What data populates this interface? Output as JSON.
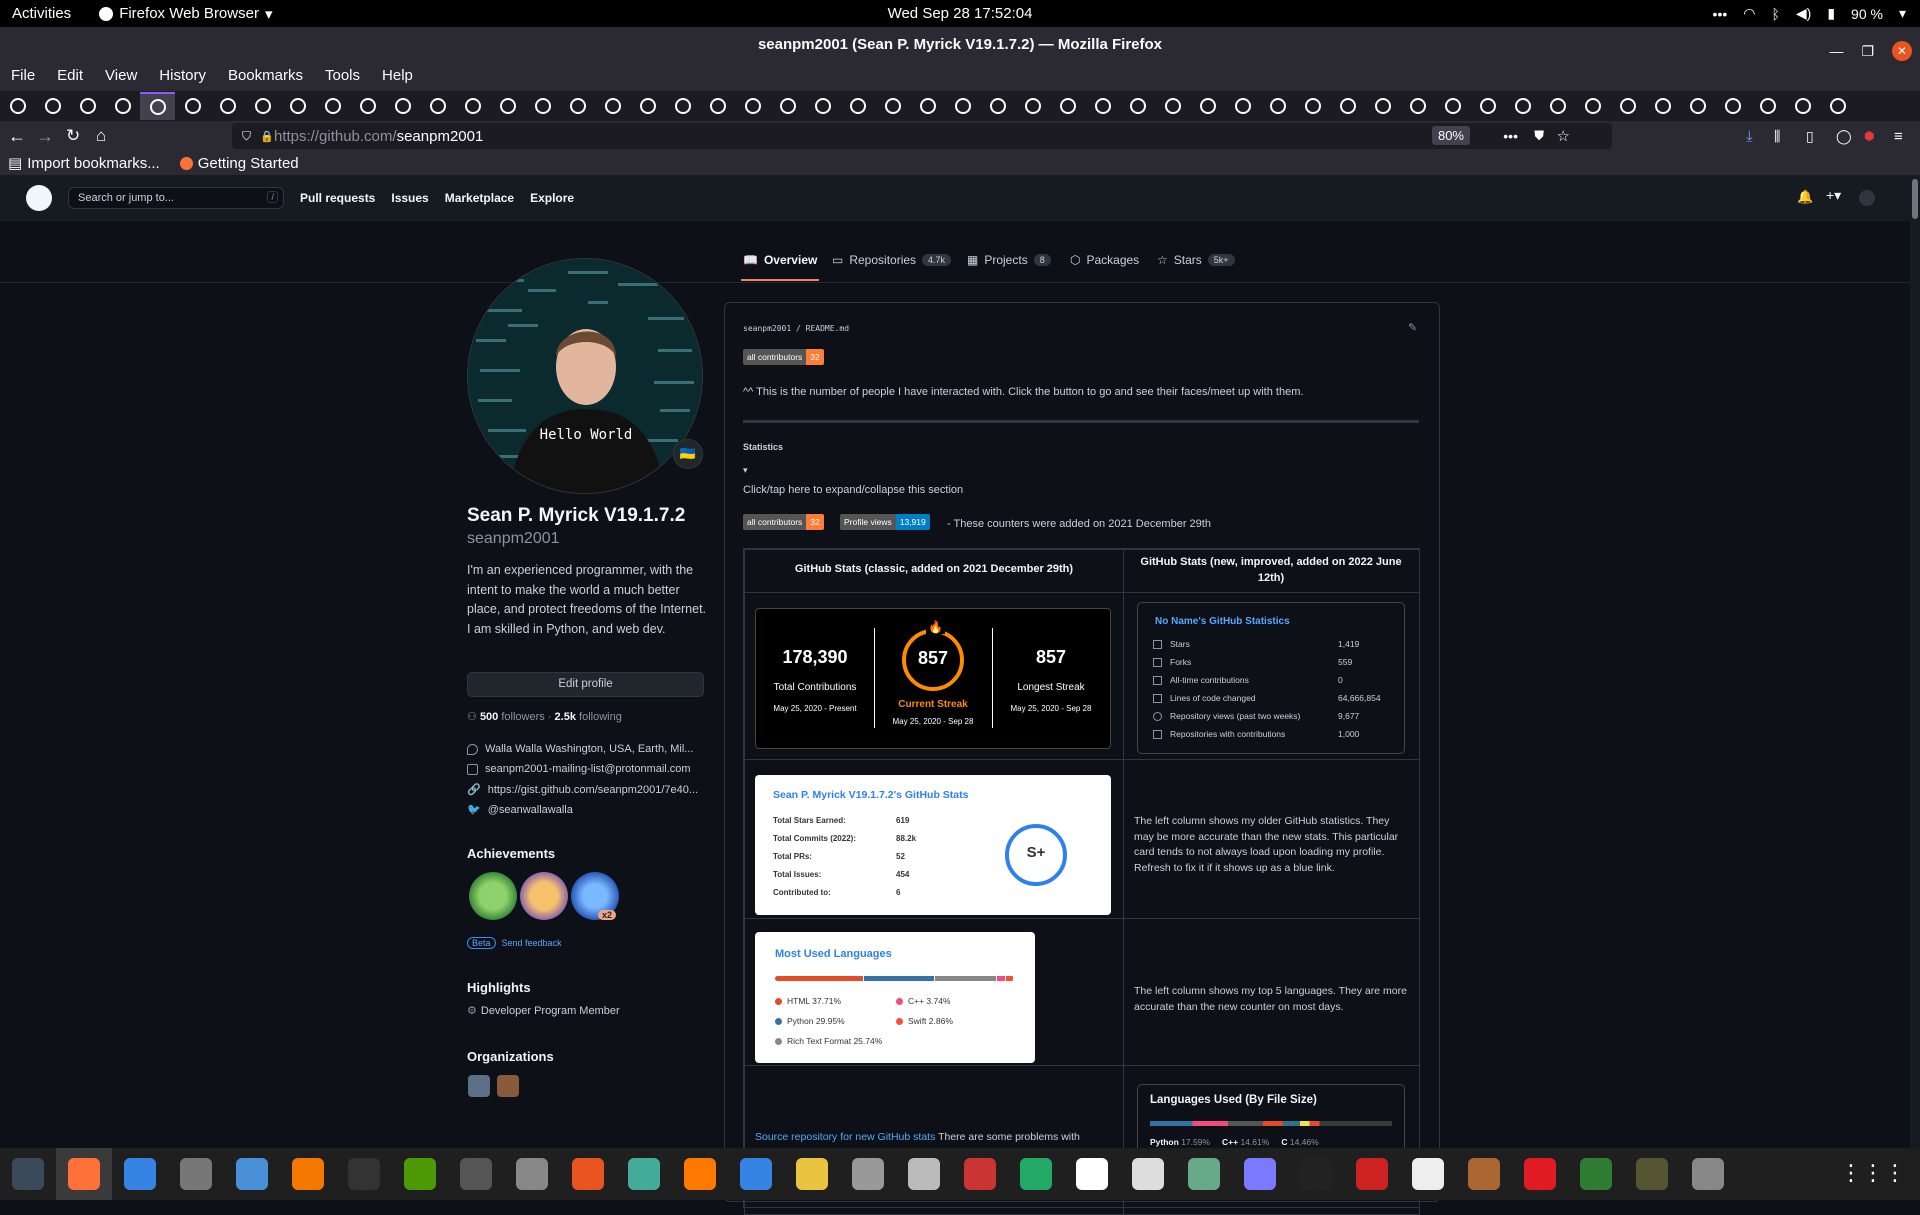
{
  "topbar": {
    "activities": "Activities",
    "app_name": "Firefox Web Browser",
    "clock": "Wed Sep 28  17:52:04",
    "battery": "90 %"
  },
  "window": {
    "title": "seanpm2001 (Sean P. Myrick V19.1.7.2) — Mozilla Firefox"
  },
  "menu": [
    "File",
    "Edit",
    "View",
    "History",
    "Bookmarks",
    "Tools",
    "Help"
  ],
  "urlbar": {
    "url_host": "https://github.com/",
    "url_path": "seanpm2001",
    "zoom": "80%"
  },
  "bookmarks": {
    "import": "Import bookmarks...",
    "getting_started": "Getting Started"
  },
  "github_header": {
    "search_placeholder": "Search or jump to...",
    "slash": "/",
    "nav": [
      "Pull requests",
      "Issues",
      "Marketplace",
      "Explore"
    ]
  },
  "profile_tabs": [
    {
      "label": "Overview",
      "count": ""
    },
    {
      "label": "Repositories",
      "count": "4.7k"
    },
    {
      "label": "Projects",
      "count": "8"
    },
    {
      "label": "Packages",
      "count": ""
    },
    {
      "label": "Stars",
      "count": "5k+"
    }
  ],
  "profile": {
    "avatar_shirt_text": "Hello World",
    "status_emoji": "🇺🇦",
    "full_name": "Sean P. Myrick V19.1.7.2",
    "login": "seanpm2001",
    "bio": "I'm an experienced programmer, with the intent to make the world a much better place, and protect freedoms of the Internet. I am skilled in Python, and web dev.",
    "edit_button": "Edit profile",
    "followers": "500",
    "followers_label": "followers",
    "following": "2.5k",
    "following_label": "following",
    "location": "Walla Walla Washington, USA, Earth, Mil...",
    "email": "seanpm2001-mailing-list@protonmail.com",
    "website": "https://gist.github.com/seanpm2001/7e40...",
    "twitter": "@seanwallawalla",
    "achievements_heading": "Achievements",
    "achievement_multiplier": "x2",
    "beta": "Beta",
    "send_feedback": "Send feedback",
    "highlights_heading": "Highlights",
    "highlight_item": "Developer Program Member",
    "organizations_heading": "Organizations"
  },
  "readme": {
    "path_user": "seanpm2001",
    "path_sep": "/",
    "path_file": "README.md",
    "badge_contrib_label": "all contributors",
    "badge_contrib_value": "32",
    "contrib_text": "^^ This is the number of people I have interacted with. Click the button to go and see their faces/meet up with them.",
    "statistics": "Statistics",
    "toggle": "▾",
    "expand_text": "Click/tap here to expand/collapse this section",
    "views_label": "Profile views",
    "views_value": "13,919",
    "counters_text": "- These counters were added on 2021 December 29th",
    "table_header_left": "GitHub Stats (classic, added on 2021 December 29th)",
    "table_header_right": "GitHub Stats (new, improved, added on 2022 June 12th)",
    "streak": {
      "total": "178,390",
      "total_label": "Total Contributions",
      "total_range": "May 25, 2020 - Present",
      "current": "857",
      "current_label": "Current Streak",
      "current_range": "May 25, 2020 - Sep 28",
      "longest": "857",
      "longest_label": "Longest Streak",
      "longest_range": "May 25, 2020 - Sep 28"
    },
    "noname": {
      "title": "No Name's GitHub Statistics",
      "rows": [
        {
          "label": "Stars",
          "value": "1,419"
        },
        {
          "label": "Forks",
          "value": "559"
        },
        {
          "label": "All-time contributions",
          "value": "0"
        },
        {
          "label": "Lines of code changed",
          "value": "64,666,854"
        },
        {
          "label": "Repository views (past two weeks)",
          "value": "9,677"
        },
        {
          "label": "Repositories with contributions",
          "value": "1,000"
        }
      ]
    },
    "gs_card": {
      "title": "Sean P. Myrick V19.1.7.2's GitHub Stats",
      "rows": [
        {
          "label": "Total Stars Earned:",
          "value": "619"
        },
        {
          "label": "Total Commits (2022):",
          "value": "88.2k"
        },
        {
          "label": "Total PRs:",
          "value": "52"
        },
        {
          "label": "Total Issues:",
          "value": "454"
        },
        {
          "label": "Contributed to:",
          "value": "6"
        }
      ],
      "grade": "S+"
    },
    "desc1": "The left column shows my older GitHub statistics. They may be more accurate than the new stats. This particular card tends to not always load upon loading my profile. Refresh to fix it if it shows up as a blue link.",
    "langs_card": {
      "title": "Most Used Languages",
      "langs": [
        {
          "name": "HTML 37.71%",
          "color": "#e34c26",
          "pct": 37.71
        },
        {
          "name": "Python 29.95%",
          "color": "#3572A5",
          "pct": 29.95
        },
        {
          "name": "Rich Text Format 25.74%",
          "color": "#888888",
          "pct": 25.74
        },
        {
          "name": "C++ 3.74%",
          "color": "#f34b7d",
          "pct": 3.74
        },
        {
          "name": "Swift 2.86%",
          "color": "#F05138",
          "pct": 2.86
        }
      ]
    },
    "desc2": "The left column shows my top 5 languages. They are more accurate than the new counter on most days.",
    "source_link": "Source repository for new GitHub stats",
    "source_text": "There are some problems with",
    "langs_used_title": "Languages Used (By File Size)",
    "langs_used": [
      {
        "name": "Python",
        "pct": "17.59%",
        "color": "#3572A5"
      },
      {
        "name": "C++",
        "pct": "14.61%",
        "color": "#f34b7d"
      },
      {
        "name": "C",
        "pct": "14.46%",
        "color": "#555555"
      }
    ]
  },
  "colors": {
    "accent_orange": "#fb8c00",
    "link_blue": "#58a6ff",
    "github_bg": "#0d1117",
    "firefox_chrome": "#2b2a33"
  }
}
